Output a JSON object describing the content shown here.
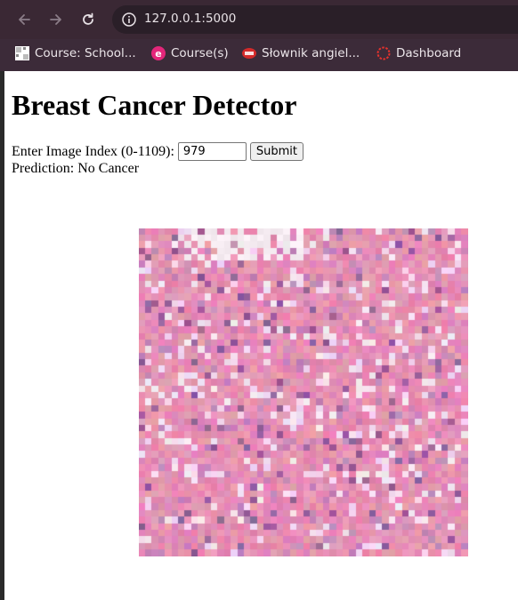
{
  "browser": {
    "url": "127.0.0.1:5000",
    "bookmarks": [
      {
        "label": "Course: School...",
        "icon": "grid-favicon-icon"
      },
      {
        "label": "Course(s)",
        "icon": "e-favicon-icon"
      },
      {
        "label": "Słownik angiel...",
        "icon": "diki-favicon-icon"
      },
      {
        "label": "Dashboard",
        "icon": "dashboard-ring-icon"
      }
    ]
  },
  "page": {
    "title": "Breast Cancer Detector",
    "form": {
      "label": "Enter Image Index (0-1109):",
      "value": "979",
      "submit_label": "Submit"
    },
    "prediction": "Prediction: No Cancer"
  }
}
